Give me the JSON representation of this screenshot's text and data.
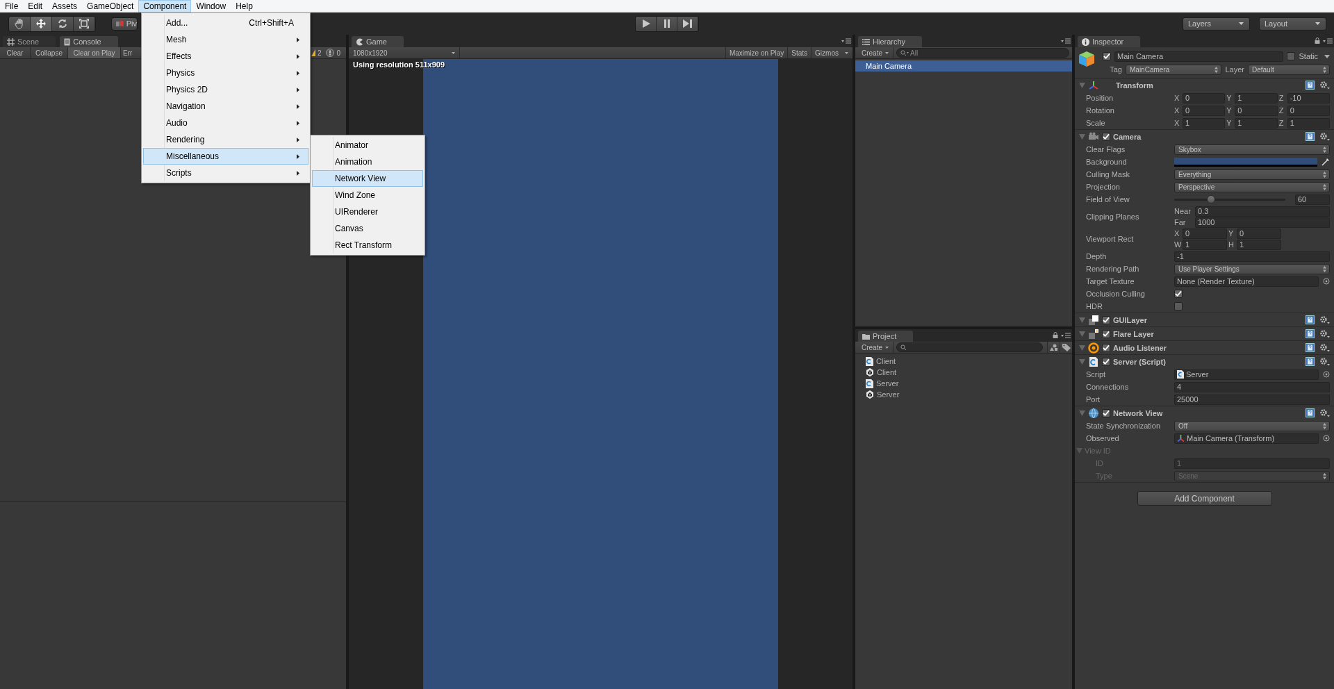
{
  "menu_bar": [
    {
      "label": "File",
      "selected": false
    },
    {
      "label": "Edit",
      "selected": false
    },
    {
      "label": "Assets",
      "selected": false
    },
    {
      "label": "GameObject",
      "selected": false
    },
    {
      "label": "Component",
      "selected": true
    },
    {
      "label": "Window",
      "selected": false
    },
    {
      "label": "Help",
      "selected": false
    }
  ],
  "component_menu": [
    {
      "label": "Add...",
      "shortcut": "Ctrl+Shift+A",
      "submenu": false,
      "selected": false
    },
    {
      "label": "Mesh",
      "submenu": true,
      "selected": false
    },
    {
      "label": "Effects",
      "submenu": true,
      "selected": false
    },
    {
      "label": "Physics",
      "submenu": true,
      "selected": false
    },
    {
      "label": "Physics 2D",
      "submenu": true,
      "selected": false
    },
    {
      "label": "Navigation",
      "submenu": true,
      "selected": false
    },
    {
      "label": "Audio",
      "submenu": true,
      "selected": false
    },
    {
      "label": "Rendering",
      "submenu": true,
      "selected": false
    },
    {
      "label": "Miscellaneous",
      "submenu": true,
      "selected": true
    },
    {
      "label": "Scripts",
      "submenu": true,
      "selected": false
    }
  ],
  "miscellaneous_submenu": [
    {
      "label": "Animator",
      "selected": false
    },
    {
      "label": "Animation",
      "selected": false
    },
    {
      "label": "Network View",
      "selected": true
    },
    {
      "label": "Wind Zone",
      "selected": false
    },
    {
      "label": "UIRenderer",
      "selected": false
    },
    {
      "label": "Canvas",
      "selected": false
    },
    {
      "label": "Rect Transform",
      "selected": false
    }
  ],
  "toolbar": {
    "tools": [
      {
        "kind": "hand",
        "selected": false
      },
      {
        "kind": "move",
        "selected": true
      },
      {
        "kind": "rotate",
        "selected": false
      },
      {
        "kind": "scale",
        "selected": false
      }
    ],
    "pivot": "Piv",
    "layers": "Layers",
    "layout": "Layout"
  },
  "console": {
    "tabs": [
      {
        "label": "Scene",
        "kind": "scene",
        "selected": false
      },
      {
        "label": "Console",
        "kind": "console",
        "selected": true
      }
    ],
    "buttons": [
      {
        "label": "Clear",
        "selected": false
      },
      {
        "label": "Collapse",
        "selected": false
      },
      {
        "label": "Clear on Play",
        "selected": true
      },
      {
        "label": "Err",
        "selected": false
      }
    ],
    "warning_count": "2",
    "error_count": "0"
  },
  "game": {
    "tab": "Game",
    "resolution": "1080x1920",
    "buttons": [
      {
        "label": "Maximize on Play",
        "selected": false
      },
      {
        "label": "Stats",
        "selected": false
      },
      {
        "label": "Gizmos",
        "selected": false
      }
    ],
    "notice": "Using resolution 511x909"
  },
  "hierarchy": {
    "tab": "Hierarchy",
    "create": "Create",
    "search_placeholder": "All",
    "items": [
      {
        "label": "Main Camera",
        "selected": true
      }
    ]
  },
  "project": {
    "tab": "Project",
    "create": "Create",
    "assets": [
      {
        "label": "Client",
        "kind": "script"
      },
      {
        "label": "Client",
        "kind": "scene"
      },
      {
        "label": "Server",
        "kind": "script"
      },
      {
        "label": "Server",
        "kind": "scene"
      }
    ]
  },
  "inspector": {
    "tab": "Inspector",
    "object": {
      "name": "Main Camera",
      "active": true,
      "static": false,
      "static_label": "Static",
      "tag_label": "Tag",
      "tag": "MainCamera",
      "layer_label": "Layer",
      "layer": "Default"
    },
    "components": [
      {
        "title": "Transform",
        "kind": "transform",
        "rows": [
          {
            "kind": "vector",
            "label": "Position",
            "fields": [
              {
                "axis": "X",
                "value": "0"
              },
              {
                "axis": "Y",
                "value": "1"
              },
              {
                "axis": "Z",
                "value": "-10"
              }
            ]
          },
          {
            "kind": "vector",
            "label": "Rotation",
            "fields": [
              {
                "axis": "X",
                "value": "0"
              },
              {
                "axis": "Y",
                "value": "0"
              },
              {
                "axis": "Z",
                "value": "0"
              }
            ]
          },
          {
            "kind": "vector",
            "label": "Scale",
            "fields": [
              {
                "axis": "X",
                "value": "1"
              },
              {
                "axis": "Y",
                "value": "1"
              },
              {
                "axis": "Z",
                "value": "1"
              }
            ]
          }
        ]
      },
      {
        "title": "Camera",
        "kind": "camera",
        "enabled": true,
        "rows": [
          {
            "kind": "dropdown",
            "label": "Clear Flags",
            "value": "Skybox"
          },
          {
            "kind": "color",
            "label": "Background",
            "color": "#314d79"
          },
          {
            "kind": "dropdown",
            "label": "Culling Mask",
            "value": "Everything"
          },
          {
            "kind": "dropdown",
            "label": "Projection",
            "value": "Perspective"
          },
          {
            "kind": "slider",
            "label": "Field of View",
            "level": 0.33,
            "value": "60"
          },
          {
            "kind": "pairs",
            "label": "Clipping Planes",
            "fields": [
              {
                "axis": "Near",
                "value": "0.3"
              },
              {
                "axis": "Far",
                "value": "1000"
              }
            ]
          },
          {
            "kind": "rect",
            "label": "Viewport Rect",
            "fields": [
              {
                "axis": "X",
                "value": "0"
              },
              {
                "axis": "Y",
                "value": "0"
              },
              {
                "axis": "W",
                "value": "1"
              },
              {
                "axis": "H",
                "value": "1"
              }
            ]
          },
          {
            "kind": "text",
            "label": "Depth",
            "value": "-1"
          },
          {
            "kind": "dropdown",
            "label": "Rendering Path",
            "value": "Use Player Settings"
          },
          {
            "kind": "object",
            "label": "Target Texture",
            "value": "None (Render Texture)"
          },
          {
            "kind": "checkbox",
            "label": "Occlusion Culling",
            "checked": true
          },
          {
            "kind": "checkbox",
            "label": "HDR",
            "checked": false
          }
        ]
      },
      {
        "title": "GUILayer",
        "kind": "guilayer",
        "enabled": true
      },
      {
        "title": "Flare Layer",
        "kind": "flare",
        "enabled": true
      },
      {
        "title": "Audio Listener",
        "kind": "audio",
        "enabled": true
      },
      {
        "title": "Server (Script)",
        "kind": "script",
        "enabled": true,
        "rows": [
          {
            "kind": "script_object",
            "label": "Script",
            "value": "Server"
          },
          {
            "kind": "text",
            "label": "Connections",
            "value": "4"
          },
          {
            "kind": "text",
            "label": "Port",
            "value": "25000"
          }
        ]
      },
      {
        "title": "Network View",
        "kind": "network",
        "enabled": true,
        "rows": [
          {
            "kind": "dropdown",
            "label": "State Synchronization",
            "value": "Off"
          },
          {
            "kind": "transform_object",
            "label": "Observed",
            "value": "Main Camera (Transform)"
          },
          {
            "kind": "foldout",
            "label": "View ID",
            "disabled": true,
            "children": [
              {
                "kind": "text",
                "label": "ID",
                "value": "1"
              },
              {
                "kind": "dropdown",
                "label": "Type",
                "value": "Scene"
              }
            ]
          }
        ]
      }
    ],
    "add_button": "Add Component"
  }
}
